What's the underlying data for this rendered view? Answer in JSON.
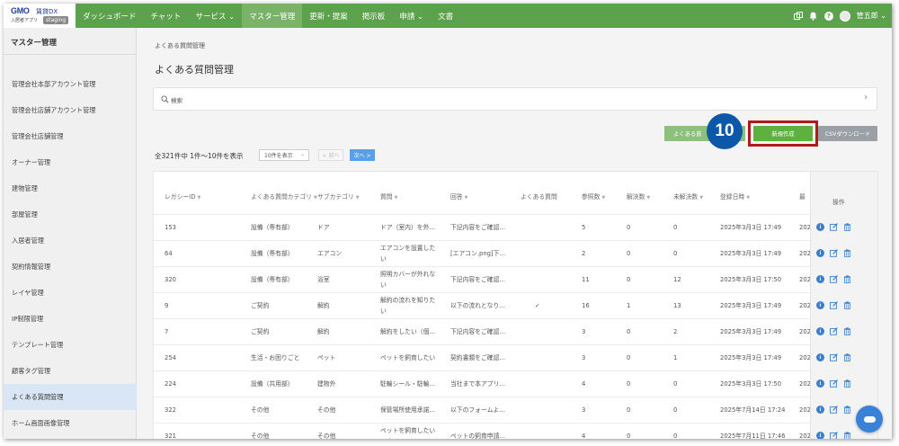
{
  "app": {
    "logo_brand": "GMO",
    "logo_product": "賃貸DX",
    "logo_sub": "入居者アプリ",
    "env_badge": "staging"
  },
  "nav": {
    "items": [
      {
        "label": "ダッシュボード",
        "active": false
      },
      {
        "label": "チャット",
        "active": false
      },
      {
        "label": "サービス ⌄",
        "active": false
      },
      {
        "label": "マスター管理",
        "active": true
      },
      {
        "label": "更新・提案",
        "active": false
      },
      {
        "label": "掲示板",
        "active": false
      },
      {
        "label": "申請 ⌄",
        "active": false
      },
      {
        "label": "文書",
        "active": false
      }
    ],
    "user_name": "管五郎 ⌄"
  },
  "sidebar": {
    "title": "マスター管理",
    "items": [
      {
        "label": "管理会社本部アカウント管理",
        "active": false
      },
      {
        "label": "管理会社店舗アカウント管理",
        "active": false
      },
      {
        "label": "管理会社店舗管理",
        "active": false
      },
      {
        "label": "オーナー管理",
        "active": false
      },
      {
        "label": "建物管理",
        "active": false
      },
      {
        "label": "部屋管理",
        "active": false
      },
      {
        "label": "入居者管理",
        "active": false
      },
      {
        "label": "契約情報管理",
        "active": false
      },
      {
        "label": "レイヤ管理",
        "active": false
      },
      {
        "label": "IP制限管理",
        "active": false
      },
      {
        "label": "テンプレート管理",
        "active": false
      },
      {
        "label": "顧客タグ管理",
        "active": false
      },
      {
        "label": "よくある質問管理",
        "active": true
      },
      {
        "label": "ホーム画面画像管理",
        "active": false
      }
    ]
  },
  "page": {
    "breadcrumb": "よくある質問管理",
    "title": "よくある質問管理",
    "search_label": "検索",
    "buttons": {
      "faq": "よくある質",
      "new": "新規作成",
      "csv": "CSVダウンロード"
    },
    "step_badge": "10",
    "count_text": "全321件中 1件〜10件を表示",
    "per_page": "10件を表示",
    "prev": "< 前へ",
    "next": "次へ >"
  },
  "table": {
    "headers": [
      "レガシーID",
      "よくある質問カテゴリ",
      "サブカテゴリ",
      "質問",
      "回答",
      "よくある質問",
      "参照数",
      "解決数",
      "未解決数",
      "登録日時",
      "最"
    ],
    "ops_header": "操作",
    "rows": [
      {
        "id": "153",
        "category": "設備（専有部）",
        "sub": "ドア",
        "question": "ドア（室内）を外…",
        "answer": "下記内容をご確認…",
        "faq": "",
        "views": "5",
        "solved": "0",
        "unsolved": "0",
        "created": "2025年3月3日 17:49",
        "last": "202"
      },
      {
        "id": "64",
        "category": "設備（専有部）",
        "sub": "エアコン",
        "question": "エアコンを設置した|い",
        "answer": "[エアコン.png]下…",
        "faq": "",
        "views": "2",
        "solved": "0",
        "unsolved": "0",
        "created": "2025年3月3日 17:49",
        "last": "202"
      },
      {
        "id": "320",
        "category": "設備（専有部）",
        "sub": "浴室",
        "question": "照明カバーが外れな|い",
        "answer": "下記内容をご確認…",
        "faq": "",
        "views": "11",
        "solved": "0",
        "unsolved": "12",
        "created": "2025年3月3日 17:50",
        "last": "202"
      },
      {
        "id": "9",
        "category": "ご契約",
        "sub": "解約",
        "question": "解約の流れを知りた|い",
        "answer": "以下の流れとなり…",
        "faq": "✓",
        "views": "16",
        "solved": "1",
        "unsolved": "13",
        "created": "2025年3月3日 17:49",
        "last": "202"
      },
      {
        "id": "7",
        "category": "ご契約",
        "sub": "解約",
        "question": "解約をしたい（個…",
        "answer": "下記内容をご確認…",
        "faq": "",
        "views": "3",
        "solved": "0",
        "unsolved": "2",
        "created": "2025年3月3日 17:49",
        "last": "202"
      },
      {
        "id": "254",
        "category": "生活・お困りごと",
        "sub": "ペット",
        "question": "ペットを飼育したい",
        "answer": "契約書類をご確認…",
        "faq": "",
        "views": "3",
        "solved": "0",
        "unsolved": "1",
        "created": "2025年3月3日 17:49",
        "last": "202"
      },
      {
        "id": "224",
        "category": "設備（共用部）",
        "sub": "建物外",
        "question": "駐輪シール・駐輪…",
        "answer": "当社まで本アプリ…",
        "faq": "",
        "views": "4",
        "solved": "0",
        "unsolved": "0",
        "created": "2025年3月3日 17:50",
        "last": "202"
      },
      {
        "id": "322",
        "category": "その他",
        "sub": "その他",
        "question": "保管場所使用承諾…",
        "answer": "以下のフォームよ…",
        "faq": "",
        "views": "3",
        "solved": "0",
        "unsolved": "0",
        "created": "2025年7月14日 17:24",
        "last": "202"
      },
      {
        "id": "321",
        "category": "その他",
        "sub": "その他",
        "question": "ペットを飼育したい|です",
        "answer": "ペットの飼育申請…",
        "faq": "",
        "views": "4",
        "solved": "0",
        "unsolved": "0",
        "created": "2025年7月11日 17:46",
        "last": "202"
      }
    ]
  },
  "colors": {
    "nav_bg": "#5ca14b",
    "new_button": "#5fb13f",
    "highlight_box": "#b01a1a",
    "step_badge": "#0d57a8",
    "next_button": "#5aa0e6"
  }
}
